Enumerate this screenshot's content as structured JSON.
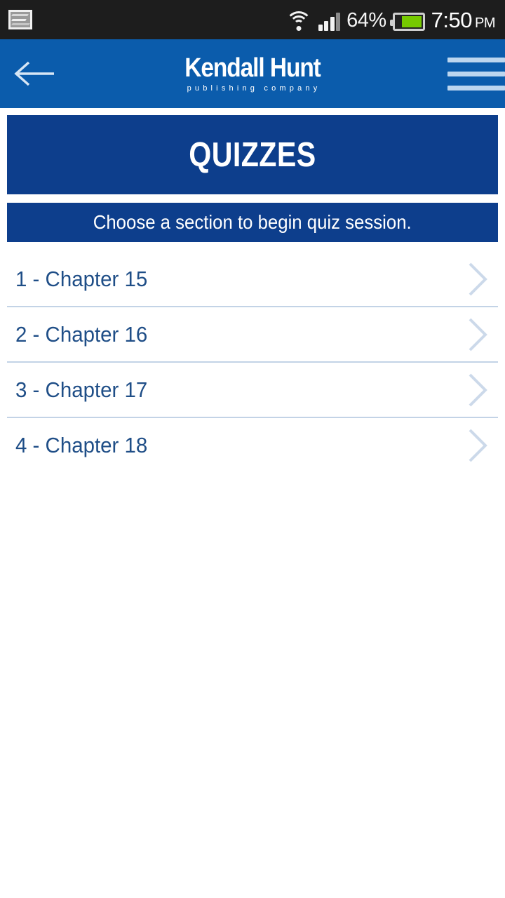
{
  "statusbar": {
    "notification_icon": "screenshot-image-icon",
    "wifi_icon": "wifi-icon",
    "signal_icon": "cellular-signal-icon",
    "battery_percent": "64%",
    "battery_icon": "battery-icon",
    "battery_color": "#76c900",
    "time": "7:50",
    "ampm": "PM"
  },
  "appbar": {
    "back_icon": "back-arrow-icon",
    "brand_name": "Kendall Hunt",
    "brand_tagline": "publishing company",
    "menu_icon": "hamburger-menu-icon",
    "background": "#0b5cac"
  },
  "page": {
    "title": "QUIZZES",
    "instruction": "Choose a section to begin quiz session.",
    "banner_color": "#0d3e8c",
    "text_color": "#1f4e87",
    "divider_color": "#c3d3e6"
  },
  "sections": [
    {
      "label": "1 - Chapter 15",
      "chevron": "chevron-right-icon"
    },
    {
      "label": "2 - Chapter 16",
      "chevron": "chevron-right-icon"
    },
    {
      "label": "3 - Chapter 17",
      "chevron": "chevron-right-icon"
    },
    {
      "label": "4 - Chapter 18",
      "chevron": "chevron-right-icon"
    }
  ]
}
